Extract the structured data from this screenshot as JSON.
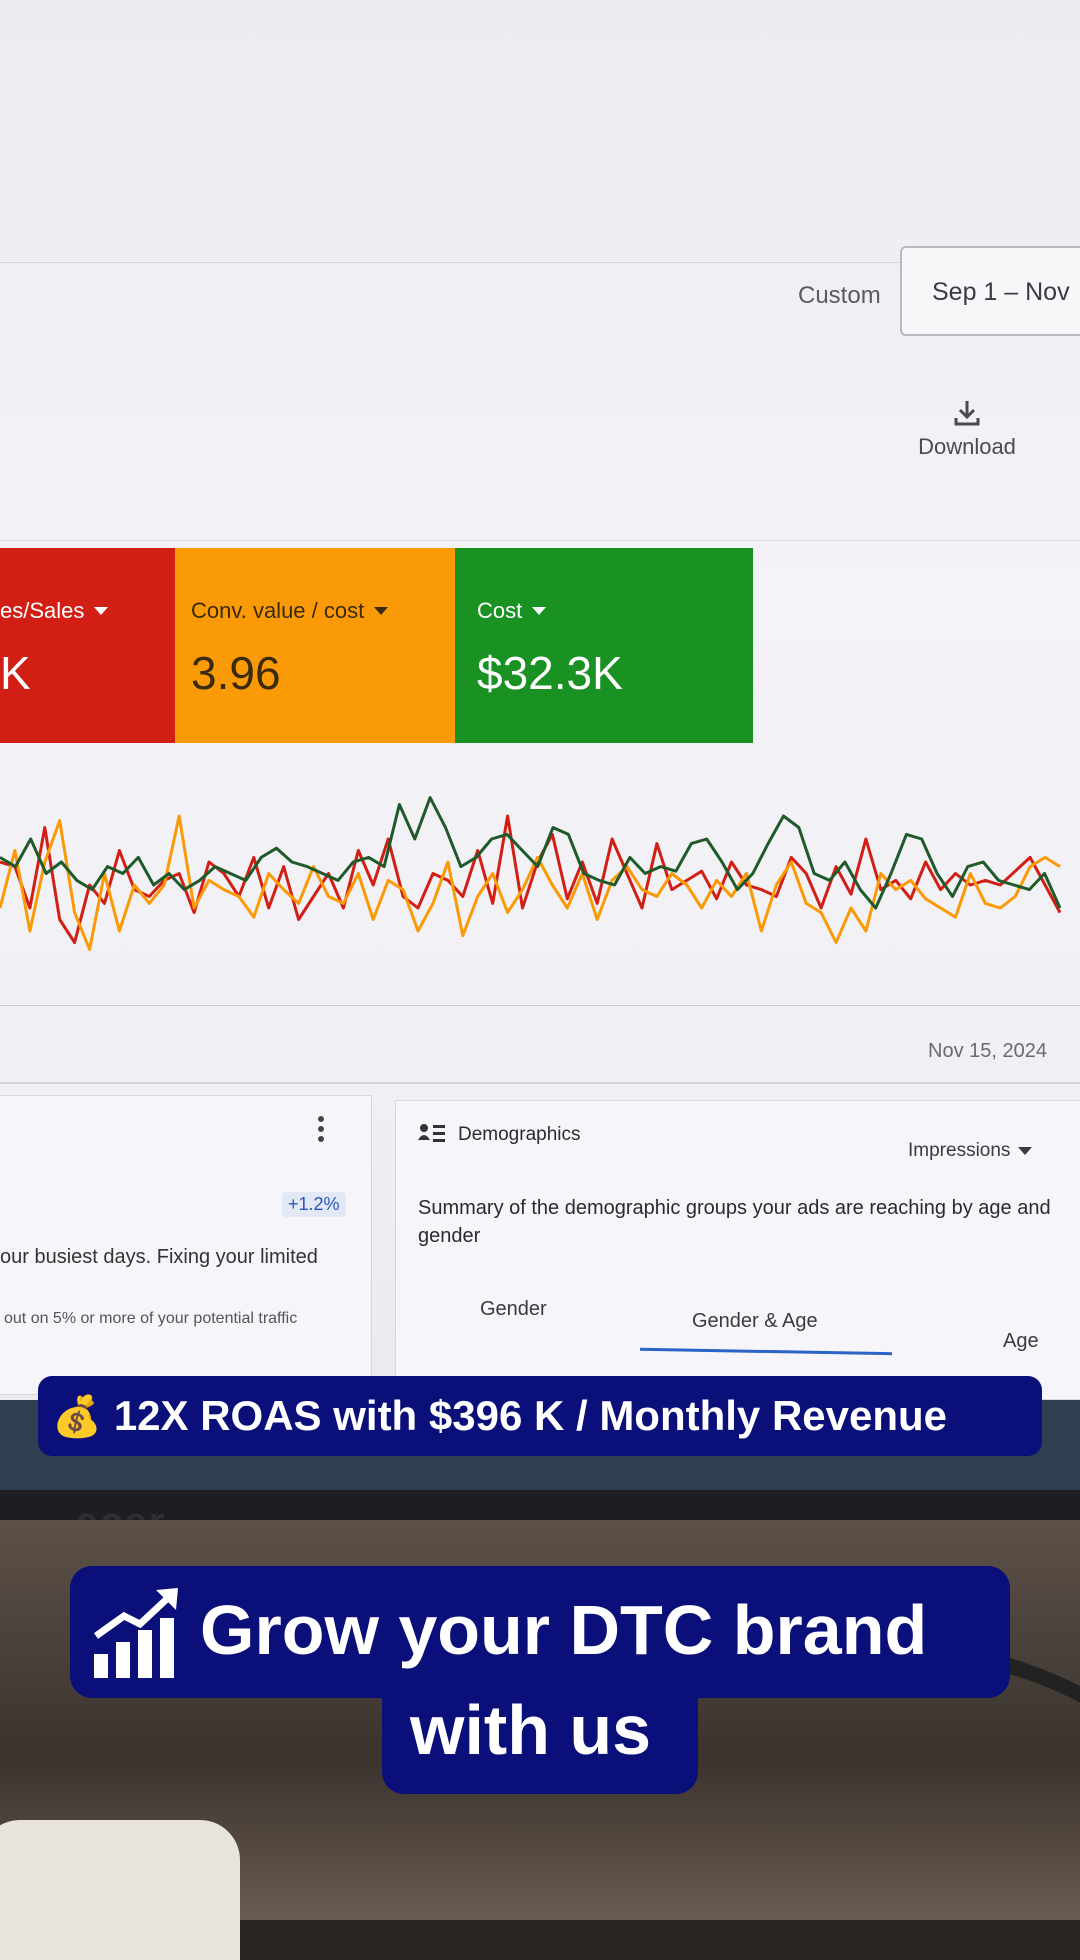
{
  "header": {
    "custom_label": "Custom",
    "date_range": "Sep 1 – Nov",
    "download_label": "Download"
  },
  "kpis": [
    {
      "label": "es/Sales",
      "value": "K",
      "color": "#d11f16"
    },
    {
      "label": "Conv. value / cost",
      "value": "3.96",
      "color": "#fa9a06"
    },
    {
      "label": "Cost",
      "value": "$32.3K",
      "color": "#1a9223"
    }
  ],
  "chart_data": {
    "type": "line",
    "x_end_label": "Nov 15, 2024",
    "series": [
      {
        "color": "#d11f16",
        "values": [
          60,
          58,
          40,
          75,
          35,
          25,
          50,
          42,
          65,
          48,
          45,
          52,
          55,
          38,
          60,
          55,
          45,
          62,
          40,
          58,
          35,
          45,
          55,
          40,
          65,
          50,
          70,
          45,
          40,
          55,
          52,
          45,
          65,
          42,
          80,
          40,
          60,
          72,
          44,
          60,
          42,
          70,
          55,
          40,
          68,
          48,
          52,
          56,
          44,
          60,
          50,
          48,
          45,
          62,
          55,
          40,
          58,
          46,
          70,
          48,
          52,
          44,
          60,
          48,
          55,
          50,
          52,
          50,
          56,
          62,
          50,
          38
        ]
      },
      {
        "color": "#fa9a06",
        "values": [
          40,
          65,
          30,
          60,
          78,
          38,
          22,
          55,
          30,
          50,
          42,
          50,
          80,
          40,
          52,
          48,
          45,
          36,
          55,
          48,
          42,
          58,
          45,
          42,
          55,
          35,
          52,
          48,
          30,
          42,
          60,
          28,
          45,
          55,
          38,
          48,
          62,
          50,
          40,
          55,
          35,
          52,
          58,
          48,
          45,
          55,
          50,
          40,
          52,
          45,
          55,
          30,
          50,
          60,
          42,
          38,
          25,
          40,
          30,
          55,
          48,
          52,
          44,
          40,
          36,
          55,
          42,
          40,
          45,
          58,
          62,
          58
        ]
      },
      {
        "color": "#1e5a2a",
        "values": [
          62,
          58,
          70,
          55,
          60,
          52,
          48,
          58,
          55,
          62,
          50,
          55,
          48,
          52,
          58,
          55,
          52,
          62,
          66,
          60,
          58,
          55,
          52,
          60,
          62,
          58,
          85,
          70,
          88,
          75,
          58,
          62,
          70,
          72,
          65,
          58,
          75,
          72,
          55,
          52,
          50,
          62,
          55,
          58,
          56,
          68,
          70,
          60,
          48,
          55,
          68,
          80,
          75,
          55,
          52,
          60,
          48,
          40,
          55,
          72,
          70,
          55,
          45,
          58,
          60,
          52,
          50,
          48,
          55,
          40
        ]
      }
    ]
  },
  "left_card": {
    "badge": "+1.2%",
    "text1": "our busiest days. Fixing your limited",
    "text2": "out on 5% or more of your potential traffic"
  },
  "demographics": {
    "title": "Demographics",
    "metric": "Impressions",
    "summary": "Summary of the demographic groups your ads are reaching by age and gender",
    "tabs": [
      "Gender",
      "Gender & Age",
      "Age"
    ]
  },
  "overlay": {
    "roas_icon": "moneybag-icon",
    "roas_text": "12X ROAS with $396 K / Monthly Revenue",
    "grow_line1": "Grow your DTC brand",
    "grow_line2": "with us",
    "brand_color": "#0a0f7a"
  },
  "bezel_logo": "acer"
}
